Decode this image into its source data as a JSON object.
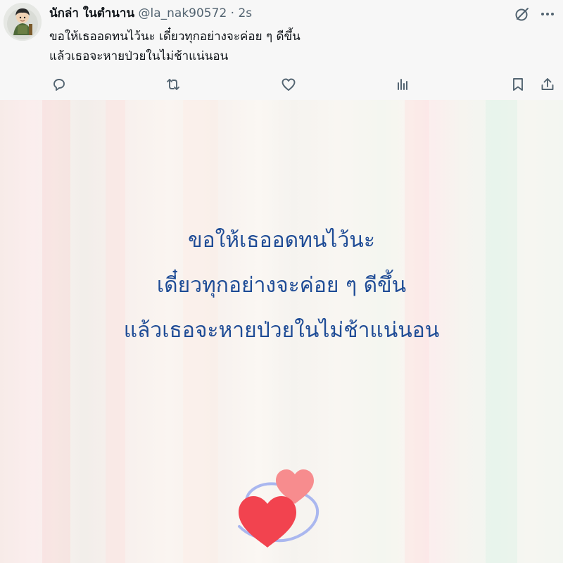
{
  "post": {
    "display_name": "นักล่า ในตำนาน",
    "handle": "@la_nak90572",
    "separator": "·",
    "time": "2s",
    "text_lines": [
      "ขอให้เธออดทนไว้นะ เดี๋ยวทุกอย่างจะค่อย ๆ ดีขึ้น",
      "แล้วเธอจะหายป่วยในไม่ช้าแน่นอน"
    ]
  },
  "header_icons": [
    "grok-icon",
    "more-icon"
  ],
  "action_bar": [
    "reply-icon",
    "repost-icon",
    "like-icon",
    "views-icon",
    "bookmark-icon",
    "share-icon"
  ],
  "media": {
    "quote_lines": [
      "ขอให้เธออดทนไว้นะ",
      "เดี๋ยวทุกอย่างจะค่อย ๆ ดีขึ้น",
      "แล้วเธอจะหายป่วยในไม่ช้าแน่นอน"
    ],
    "decoration": "two-hearts-icon"
  },
  "colors": {
    "text_primary": "#0f1419",
    "text_secondary": "#536471",
    "quote_text": "#1f4c96",
    "heart_front": "#f2434f",
    "heart_back": "#f78c8e",
    "swirl": "#aab7ef"
  }
}
